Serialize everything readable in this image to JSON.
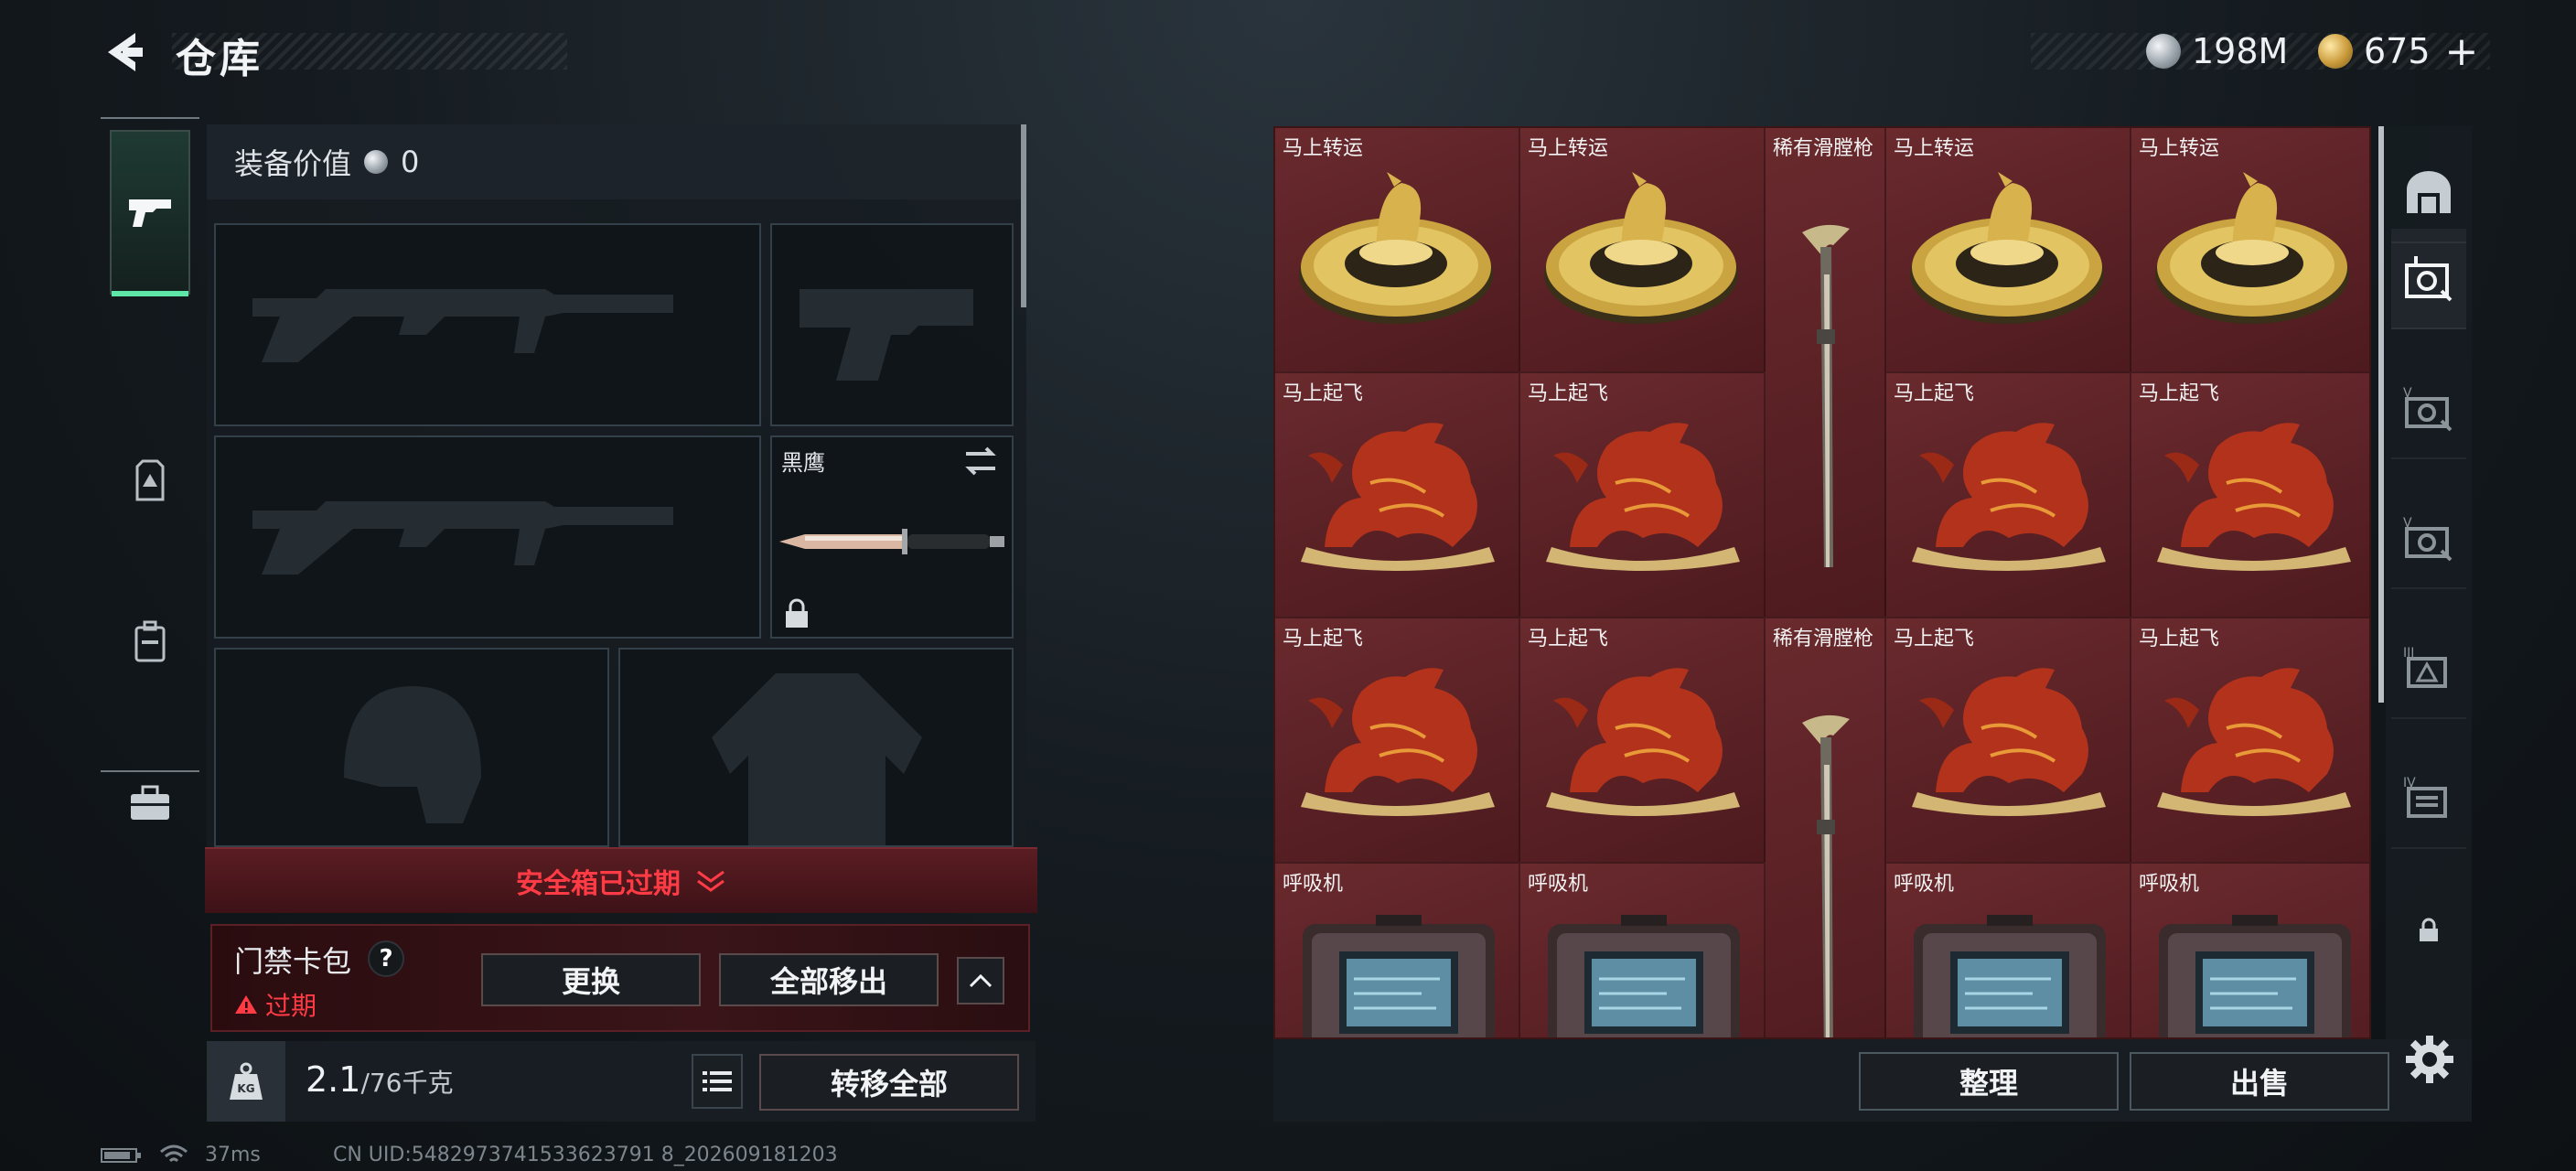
{
  "header": {
    "title": "仓库"
  },
  "currency": {
    "silver": "198M",
    "gold": "675",
    "plus": "+"
  },
  "loadout": {
    "value_label": "装备价值",
    "value": "0",
    "melee_label": "黑鹰",
    "safe_box_status": "安全箱已过期",
    "card_pack": {
      "title": "门禁卡包",
      "help": "?",
      "status": "过期",
      "replace_label": "更换",
      "move_all_label": "全部移出"
    },
    "weight": {
      "current": "2.1",
      "max": "/76千克"
    },
    "transfer_all_label": "转移全部"
  },
  "storage": {
    "cells": [
      {
        "label": "马上转运",
        "kind": "coin"
      },
      {
        "label": "马上转运",
        "kind": "coin"
      },
      {
        "label": "稀有滑膛枪",
        "kind": "musket"
      },
      {
        "label": "马上转运",
        "kind": "coin"
      },
      {
        "label": "马上转运",
        "kind": "coin"
      },
      {
        "label": "马上起飞",
        "kind": "horse"
      },
      {
        "label": "马上起飞",
        "kind": "horse"
      },
      {
        "label": "马上起飞",
        "kind": "horse"
      },
      {
        "label": "马上起飞",
        "kind": "horse"
      },
      {
        "label": "马上起飞",
        "kind": "horse"
      },
      {
        "label": "马上起飞",
        "kind": "horse"
      },
      {
        "label": "稀有滑膛枪",
        "kind": "musket"
      },
      {
        "label": "马上起飞",
        "kind": "horse"
      },
      {
        "label": "马上起飞",
        "kind": "horse"
      },
      {
        "label": "呼吸机",
        "kind": "ventilator"
      },
      {
        "label": "呼吸机",
        "kind": "ventilator"
      },
      {
        "label": "呼吸机",
        "kind": "ventilator"
      },
      {
        "label": "呼吸机",
        "kind": "ventilator"
      }
    ],
    "sort_label": "整理",
    "sell_label": "出售"
  },
  "right_tabs": [
    "home-tab",
    "vault-1",
    "vault-2",
    "vault-3",
    "vault-4",
    "vault-5",
    "locked"
  ],
  "status": {
    "ping": "37ms",
    "uid": "CN UID:5482973741533623791 8_202609181203"
  },
  "colors": {
    "accent_green": "#5ee6a8",
    "expired_red": "#ff3b45",
    "cell_red": "#5c2327"
  }
}
